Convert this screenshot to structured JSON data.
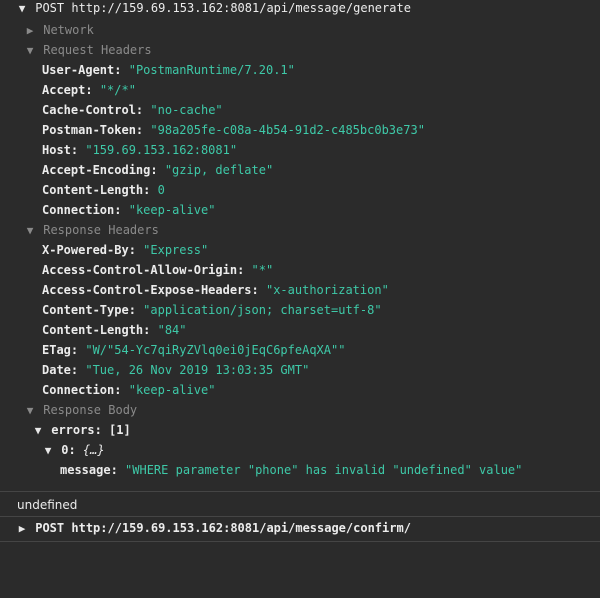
{
  "request1": {
    "method": "POST",
    "url": "http://159.69.153.162:8081/api/message/generate"
  },
  "sections": {
    "network": "Network",
    "request_headers": "Request Headers",
    "response_headers": "Response Headers",
    "response_body": "Response Body"
  },
  "request_headers": [
    {
      "key": "User-Agent:",
      "value": "\"PostmanRuntime/7.20.1\""
    },
    {
      "key": "Accept:",
      "value": "\"*/*\""
    },
    {
      "key": "Cache-Control:",
      "value": "\"no-cache\""
    },
    {
      "key": "Postman-Token:",
      "value": "\"98a205fe-c08a-4b54-91d2-c485bc0b3e73\""
    },
    {
      "key": "Host:",
      "value": "\"159.69.153.162:8081\""
    },
    {
      "key": "Accept-Encoding:",
      "value": "\"gzip, deflate\""
    },
    {
      "key": "Content-Length:",
      "value": "0"
    },
    {
      "key": "Connection:",
      "value": "\"keep-alive\""
    }
  ],
  "response_headers": [
    {
      "key": "X-Powered-By:",
      "value": "\"Express\""
    },
    {
      "key": "Access-Control-Allow-Origin:",
      "value": "\"*\""
    },
    {
      "key": "Access-Control-Expose-Headers:",
      "value": "\"x-authorization\""
    },
    {
      "key": "Content-Type:",
      "value": "\"application/json; charset=utf-8\""
    },
    {
      "key": "Content-Length:",
      "value": "\"84\""
    },
    {
      "key": "ETag:",
      "value": "\"W/\"54-Yc7qiRyZVlq0ei0jEqC6pfeAqXA\"\""
    },
    {
      "key": "Date:",
      "value": "\"Tue, 26 Nov 2019 13:03:35 GMT\""
    },
    {
      "key": "Connection:",
      "value": "\"keep-alive\""
    }
  ],
  "body": {
    "errors_key": "errors:",
    "errors_count": "[1]",
    "item_key": "0:",
    "item_preview": "{…}",
    "message_key": "message:",
    "message_value": "\"WHERE parameter \"phone\" has invalid \"undefined\" value\""
  },
  "console_output": "undefined",
  "request2": {
    "method": "POST",
    "url": "http://159.69.153.162:8081/api/message/confirm/"
  },
  "icons": {
    "expanded": "▼",
    "collapsed": "▶"
  },
  "colors": {
    "background": "#2b2b2b",
    "string": "#3ec9a8",
    "section": "#8a8a8a"
  }
}
